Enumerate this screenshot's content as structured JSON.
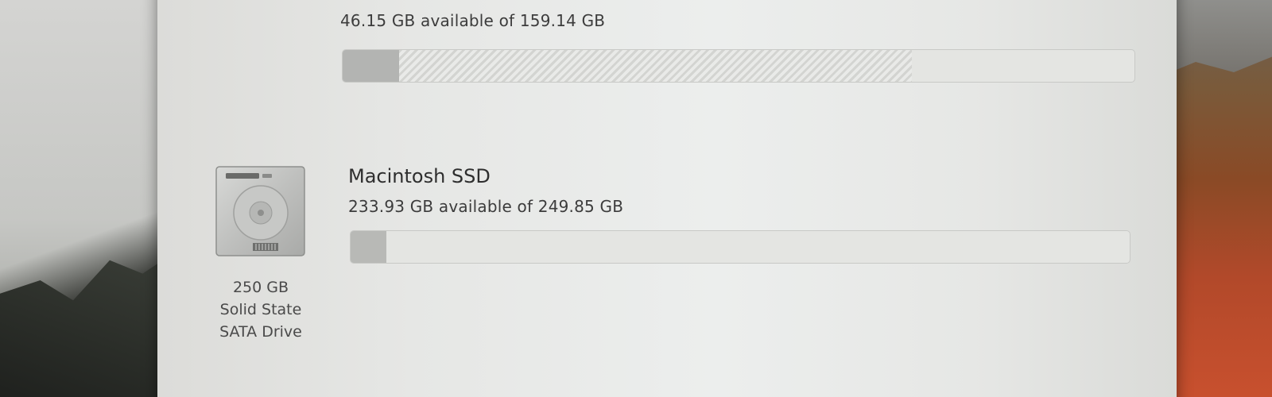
{
  "volumes": [
    {
      "available_text": "46.15 GB available of 159.14 GB",
      "used_fraction": 0.071,
      "other_fraction": 0.648
    },
    {
      "name": "Macintosh SSD",
      "available_text": "233.93 GB available of 249.85 GB",
      "used_fraction": 0.046
    }
  ],
  "disk": {
    "icon": "hard-drive-icon",
    "caption_lines": [
      "250 GB",
      "Solid State",
      "SATA Drive"
    ]
  }
}
